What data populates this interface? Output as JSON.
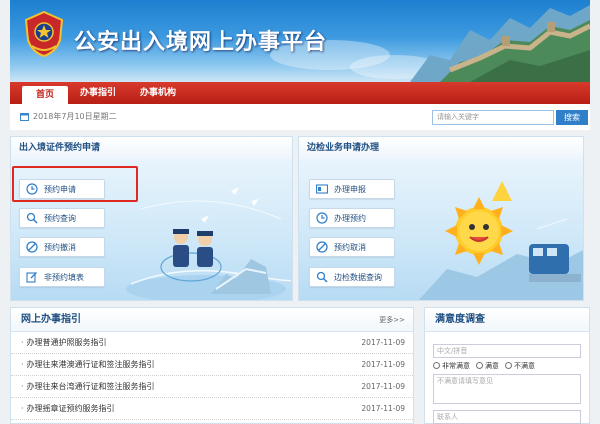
{
  "header": {
    "title": "公安出入境网上办事平台"
  },
  "nav": {
    "items": [
      "首页",
      "办事指引",
      "办事机构"
    ]
  },
  "toolbar": {
    "date": "2018年7月10日星期二",
    "search_placeholder": "请输入关键字",
    "search_button": "搜索"
  },
  "panels": {
    "left": {
      "title": "出入境证件预约申请",
      "buttons": [
        "预约申请",
        "预约查询",
        "预约撤消",
        "非预约填表"
      ]
    },
    "right": {
      "title": "边检业务申请办理",
      "buttons": [
        "办理申报",
        "办理预约",
        "预约取消",
        "边检数据查询"
      ]
    }
  },
  "guide": {
    "title": "网上办事指引",
    "more": "更多>>",
    "items": [
      {
        "title": "办理普通护照服务指引",
        "date": "2017-11-09"
      },
      {
        "title": "办理往来港澳通行证和签注服务指引",
        "date": "2017-11-09"
      },
      {
        "title": "办理往来台湾通行证和签注服务指引",
        "date": "2017-11-09"
      },
      {
        "title": "办理摇章证预约服务指引",
        "date": "2017-11-09"
      }
    ]
  },
  "survey": {
    "title": "满意度调查",
    "name_placeholder": "中文/拼音",
    "options": [
      "非常满意",
      "满意",
      "不满意"
    ],
    "reason_placeholder": "不满意请填写意见",
    "contact_placeholder": "联系人"
  },
  "colors": {
    "brand_blue": "#1d7fcf",
    "nav_red": "#c0231a",
    "highlight_red": "#e02a21"
  }
}
